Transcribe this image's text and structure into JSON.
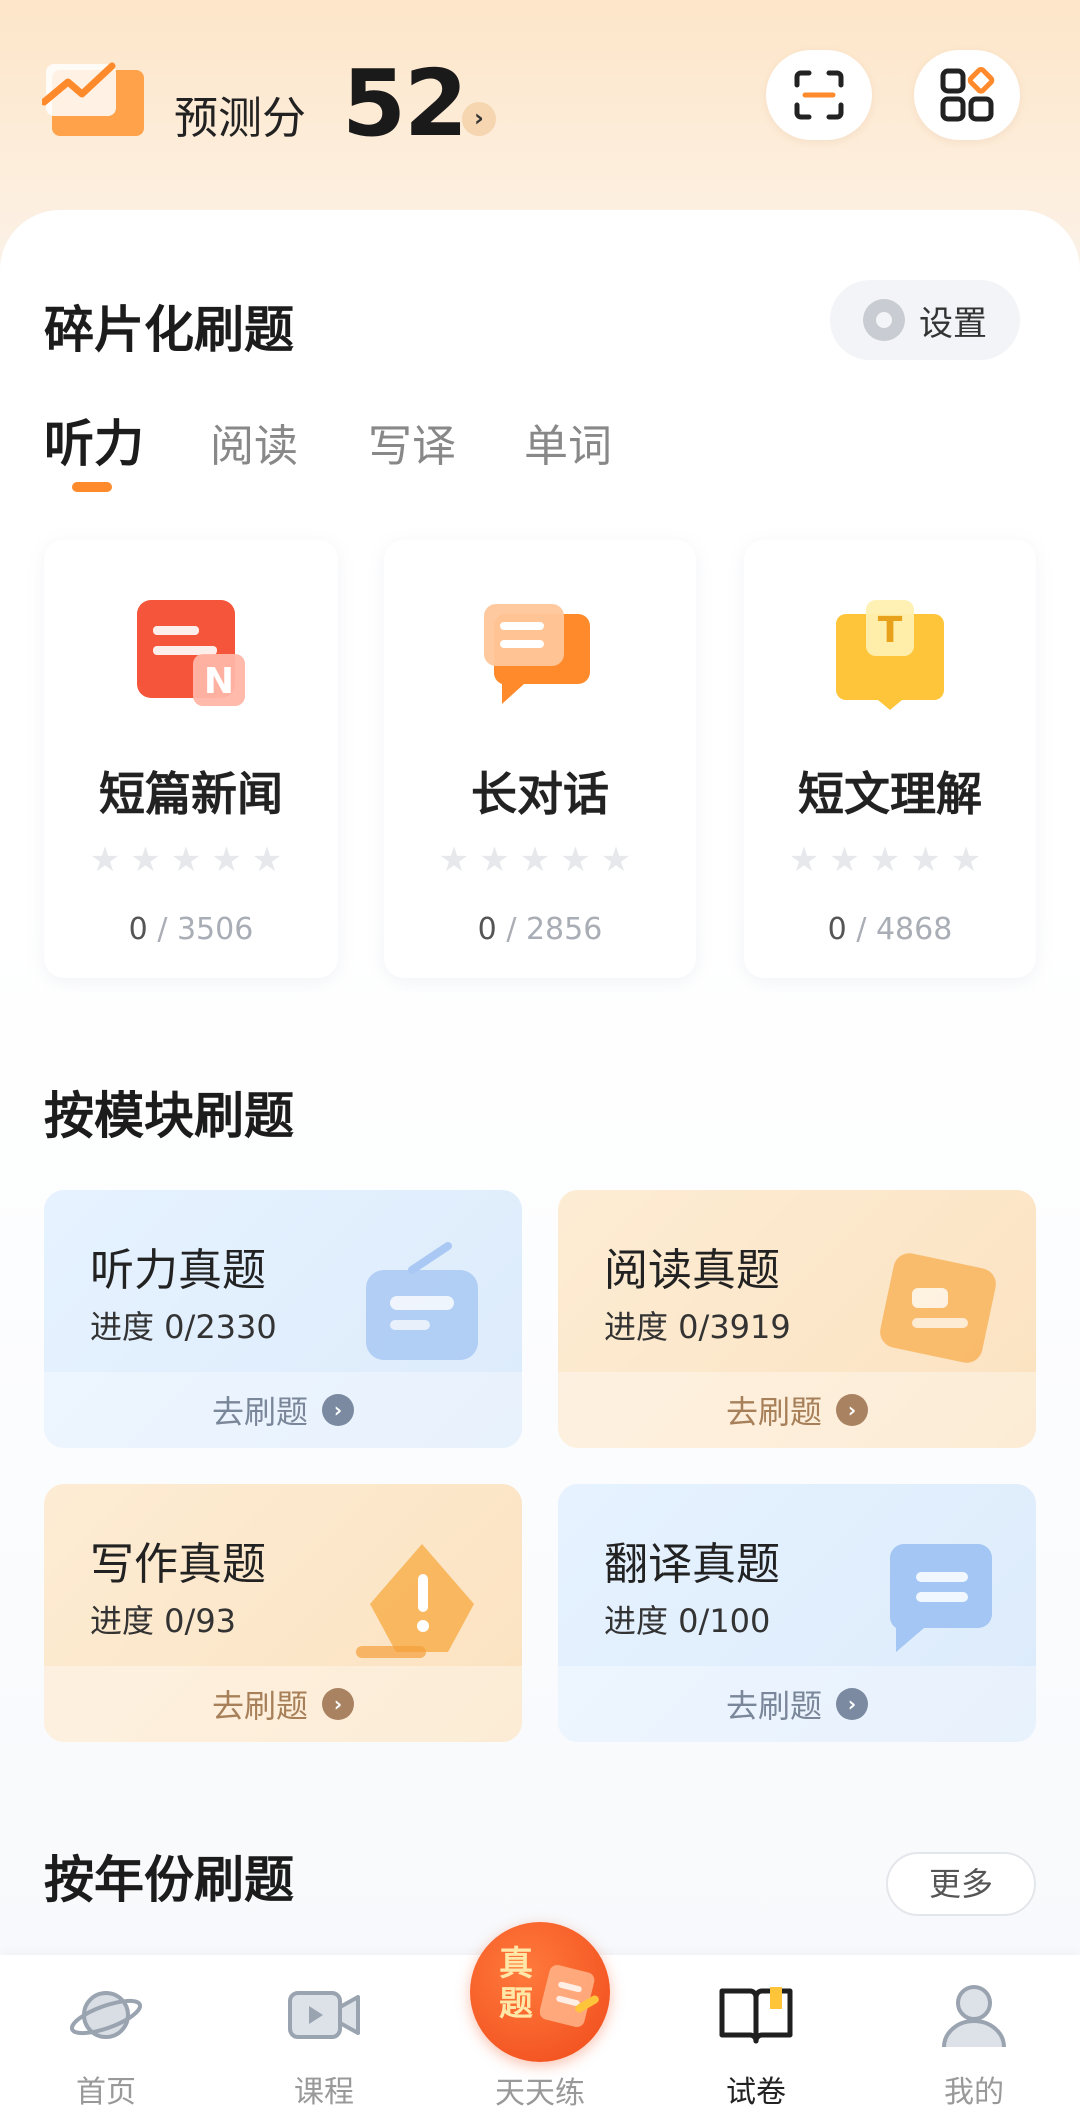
{
  "header": {
    "score_label": "预测分",
    "score_value": "52",
    "score_arrow": "›",
    "scan_icon": "scan-icon",
    "apps_icon": "apps-grid-icon"
  },
  "fragment": {
    "title": "碎片化刷题",
    "settings_label": "设置",
    "tabs": [
      "听力",
      "阅读",
      "写译",
      "单词"
    ],
    "active_tab": "听力",
    "cards": [
      {
        "name": "短篇新闻",
        "done": "0",
        "total": "/ 3506",
        "stars": "★★★★★",
        "rating": 0
      },
      {
        "name": "长对话",
        "done": "0",
        "total": "/ 2856",
        "stars": "★★★★★",
        "rating": 0
      },
      {
        "name": "短文理解",
        "done": "0",
        "total": "/ 4868",
        "stars": "★★★★★",
        "rating": 0
      }
    ]
  },
  "modules": {
    "title": "按模块刷题",
    "items": [
      {
        "title": "听力真题",
        "progress": "进度 0/2330",
        "action": "去刷题",
        "color": "blue"
      },
      {
        "title": "阅读真题",
        "progress": "进度 0/3919",
        "action": "去刷题",
        "color": "orange"
      },
      {
        "title": "写作真题",
        "progress": "进度 0/93",
        "action": "去刷题",
        "color": "orange"
      },
      {
        "title": "翻译真题",
        "progress": "进度 0/100",
        "action": "去刷题",
        "color": "blue"
      }
    ]
  },
  "by_year": {
    "title": "按年份刷题",
    "more_label": "更多"
  },
  "nav": {
    "items": [
      {
        "label": "首页",
        "icon": "planet-icon"
      },
      {
        "label": "课程",
        "icon": "video-icon"
      },
      {
        "label": "天天练",
        "icon": "daily-practice-icon",
        "badge": "真题"
      },
      {
        "label": "试卷",
        "icon": "book-icon",
        "active": true
      },
      {
        "label": "我的",
        "icon": "user-icon"
      }
    ]
  },
  "colors": {
    "accent": "#ff8a2b",
    "center_button": "#f04a1a",
    "card_blue": "#e3effc",
    "card_orange": "#fce6c8"
  }
}
